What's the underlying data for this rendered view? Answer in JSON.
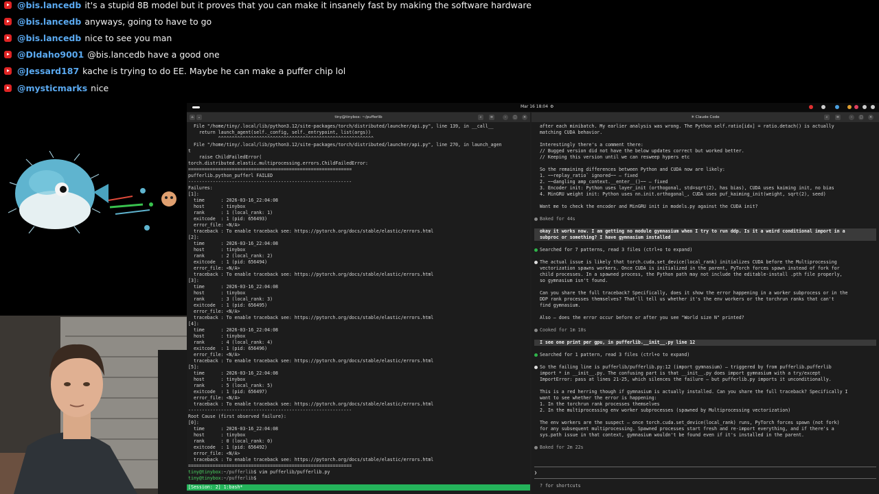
{
  "chat": [
    {
      "user": "@bis.lancedb",
      "text": "it's a stupid 8B model but it proves that you can make it insanely fast by making the software hardware"
    },
    {
      "user": "@bis.lancedb",
      "text": "anyways, going to have to go"
    },
    {
      "user": "@bis.lancedb",
      "text": "nice to see you man"
    },
    {
      "user": "@DIdaho9001",
      "text": "@bis.lancedb have a good one"
    },
    {
      "user": "@Jessard187",
      "text": "kache is trying to do EE. Maybe he can make a puffer chip lol"
    },
    {
      "user": "@mysticmarks",
      "text": "nice"
    }
  ],
  "topbar": {
    "clock": "Mar 16 18:04"
  },
  "left_window": {
    "title": "tiny@tinybox: ~/pufferlib",
    "lines": [
      "  File \"/home/tiny/.local/lib/python3.12/site-packages/torch/distributed/launcher/api.py\", line 139, in __call__",
      "    return launch_agent(self._config, self._entrypoint, list(args))",
      "           ^^^^^^^^^^^^^^^^^^^^^^^^^^^^^^^^^^^^^^^^^^^^^^^^^^^^^^^^^",
      "  File \"/home/tiny/.local/lib/python3.12/site-packages/torch/distributed/launcher/api.py\", line 270, in launch_agen",
      "t",
      "    raise ChildFailedError(",
      "torch.distributed.elastic.multiprocessing.errors.ChildFailedError:",
      "============================================================",
      "pufferlib.python_pufferl FAILED",
      "------------------------------------------------------------",
      "Failures:",
      "[1]:",
      "  time      : 2026-03-16_22:04:08",
      "  host      : tinybox",
      "  rank      : 1 (local_rank: 1)",
      "  exitcode  : 1 (pid: 656493)",
      "  error_file: <N/A>",
      "  traceback : To enable traceback see: https://pytorch.org/docs/stable/elastic/errors.html",
      "[2]:",
      "  time      : 2026-03-16_22:04:08",
      "  host      : tinybox",
      "  rank      : 2 (local_rank: 2)",
      "  exitcode  : 1 (pid: 656494)",
      "  error_file: <N/A>",
      "  traceback : To enable traceback see: https://pytorch.org/docs/stable/elastic/errors.html",
      "[3]:",
      "  time      : 2026-03-16_22:04:08",
      "  host      : tinybox",
      "  rank      : 3 (local_rank: 3)",
      "  exitcode  : 1 (pid: 656495)",
      "  error_file: <N/A>",
      "  traceback : To enable traceback see: https://pytorch.org/docs/stable/elastic/errors.html",
      "[4]:",
      "  time      : 2026-03-16_22:04:08",
      "  host      : tinybox",
      "  rank      : 4 (local_rank: 4)",
      "  exitcode  : 1 (pid: 656496)",
      "  error_file: <N/A>",
      "  traceback : To enable traceback see: https://pytorch.org/docs/stable/elastic/errors.html",
      "[5]:",
      "  time      : 2026-03-16_22:04:08",
      "  host      : tinybox",
      "  rank      : 5 (local_rank: 5)",
      "  exitcode  : 1 (pid: 656497)",
      "  error_file: <N/A>",
      "  traceback : To enable traceback see: https://pytorch.org/docs/stable/elastic/errors.html",
      "------------------------------------------------------------",
      "Root Cause (first observed failure):",
      "[0]:",
      "  time      : 2026-03-16_22:04:08",
      "  host      : tinybox",
      "  rank      : 0 (local_rank: 0)",
      "  exitcode  : 1 (pid: 656492)",
      "  error_file: <N/A>",
      "  traceback : To enable traceback see: https://pytorch.org/docs/stable/elastic/errors.html",
      "============================================================"
    ],
    "prompt1_user": "tiny@tinybox",
    "prompt1_path": ":~/pufferlib",
    "prompt1_cmd": "$ vim pufferlib/pufferlib.py",
    "prompt2_user": "tiny@tinybox",
    "prompt2_path": ":~/pufferlib",
    "prompt2_cmd": "$ ",
    "status": "[Session: 2] 1:bash*"
  },
  "right_window": {
    "title": "✳ Claude Code",
    "block1": [
      "  after each minibatch. My earlier analysis was wrong. The Python self.ratio[idx] = ratio.detach() is actually",
      "  matching CUDA behavior.",
      "",
      "  Interestingly there's a comment there:",
      "  // Bugged version did not have the below updates correct but worked better.",
      "  // Keeping this version until we can resweep hypers etc",
      "",
      "  So the remaining differences between Python and CUDA now are likely:",
      "  1. ~~replay_ratio` ignored~~ — fixed",
      "  2. ~~dangling amp_context.__enter__()~~ — fixed",
      "  3. Encoder init: Python uses layer_init (orthogonal, std=sqrt(2), has bias), CUDA uses kaiming init, no bias",
      "  4. MinGRU weight init: Python uses nn.init.orthogonal_, CUDA uses puf_kaiming_init(weight, sqrt(2), seed)",
      "",
      "  Want me to check the encoder and MinGRU init in models.py against the CUDA init?",
      ""
    ],
    "baked1": "Baked for 44s",
    "user_msg1": [
      "  okay it works now. I am getting no module gymnasium when I try to run ddp. Is it a weird conditional import in a",
      "  subproc or something? I have gymnasium installed"
    ],
    "searched1": "Searched for 7 patterns, read 3 files (ctrl+o to expand)",
    "block2": [
      "The actual issue is likely that torch.cuda.set_device(local_rank) initializes CUDA before the Multiprocessing",
      "  vectorization spawns workers. Once CUDA is initialized in the parent, PyTorch forces spawn instead of fork for",
      "  child processes. In a spawned process, the Python path may not include the editable-install .pth file properly,",
      "  so gymnasium isn't found.",
      "",
      "  Can you share the full traceback? Specifically, does it show the error happening in a worker subprocess or in the",
      "  DDP rank processes themselves? That'll tell us whether it's the env workers or the torchrun ranks that can't",
      "  find gymnasium.",
      "",
      "  Also — does the error occur before or after you see \"World size N\" printed?",
      ""
    ],
    "cooked": "Cooked for 1m 10s",
    "user_msg2": "  I see one print per gpu, in pufferlib.__init__.py line 12",
    "searched2": "Searched for 1 pattern, read 3 files (ctrl+o to expand)",
    "block3": [
      "So the failing line is pufferlib/pufferlib.py:12 (import gymnasium) — triggered by from pufferlib.pufferlib",
      "  import * in __init__.py. The confusing part is that __init__.py does import gymnasium with a try/except",
      "  ImportError: pass at lines 21-25, which silences the failure — but pufferlib.py imports it unconditionally.",
      "",
      "  This is a red herring though if gymnasium is actually installed. Can you share the full traceback? Specifically I",
      "  want to see whether the error is happening:",
      "  1. In the torchrun rank processes themselves",
      "  2. In the multiprocessing env worker subprocesses (spawned by Multiprocessing vectorization)",
      "",
      "  The env workers are the suspect — once torch.cuda.set_device(local_rank) runs, PyTorch forces spawn (not fork)",
      "  for any subsequent multiprocessing. Spawned processes start fresh and re-import everything, and if there's a",
      "  sys.path issue in that context, gymnasium wouldn't be found even if it's installed in the parent.",
      ""
    ],
    "baked2": "Baked for 2m 22s",
    "input_prompt": "❯",
    "hint": "? for shortcuts"
  }
}
